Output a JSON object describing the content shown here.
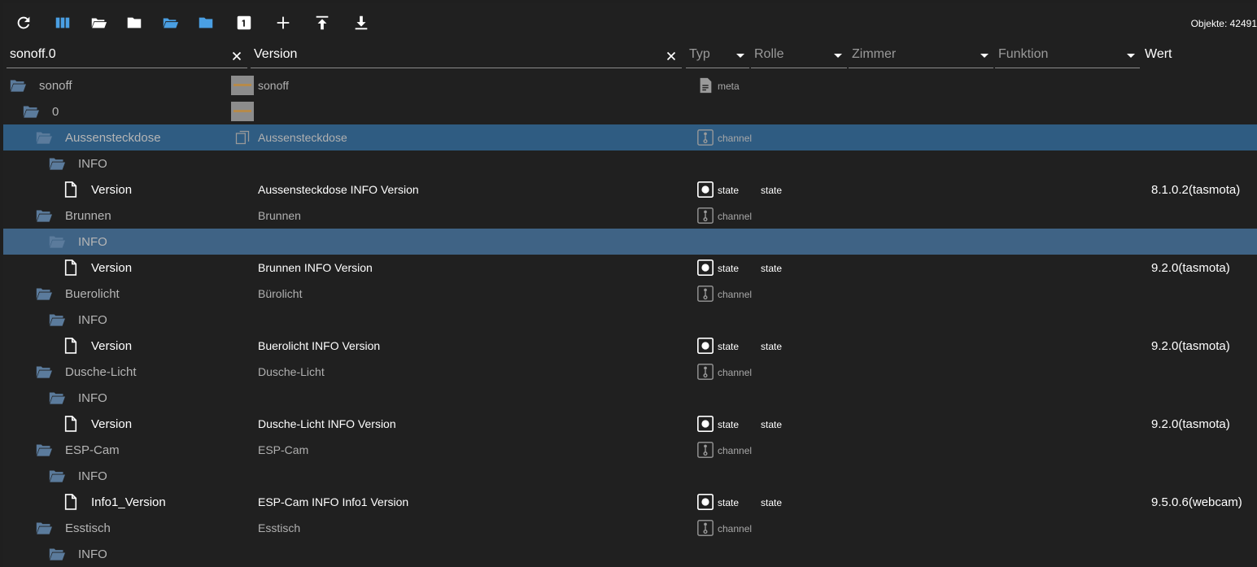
{
  "toolbar": {
    "buttons": [
      {
        "name": "refresh-icon"
      },
      {
        "name": "columns-icon"
      },
      {
        "name": "folder-open-icon"
      },
      {
        "name": "folder-closed-icon"
      },
      {
        "name": "folder-open-blue-icon"
      },
      {
        "name": "folder-closed-blue-icon"
      },
      {
        "name": "number-one-icon"
      },
      {
        "name": "plus-icon"
      },
      {
        "name": "upload-icon"
      },
      {
        "name": "download-icon"
      }
    ],
    "objects_count": "Objekte: 42491"
  },
  "filters": {
    "id": "sonoff.0",
    "name": "Version",
    "typ": "Typ",
    "rolle": "Rolle",
    "zimmer": "Zimmer",
    "funktion": "Funktion",
    "wert": "Wert"
  },
  "colors": {
    "accent_blue": "#4a9fe3",
    "folder_icon": "#5b7b9c",
    "selected_row": "#2f5c82",
    "selected_row_2": "#3f6385"
  },
  "rows": [
    {
      "name": "sonoff",
      "title": "sonoff",
      "type": "meta",
      "role": "",
      "value": "",
      "icon": "folder-open-icon",
      "title_icon": "image"
    },
    {
      "name": "0",
      "title": "",
      "type": "",
      "role": "",
      "value": "",
      "icon": "folder-open-icon",
      "title_icon": "image"
    },
    {
      "name": "Aussensteckdose",
      "title": "Aussensteckdose",
      "type": "channel",
      "role": "",
      "value": "",
      "icon": "folder-open-icon",
      "title_icon": "copy"
    },
    {
      "name": "INFO",
      "title": "",
      "type": "",
      "role": "",
      "value": "",
      "icon": "folder-open-icon"
    },
    {
      "name": "Version",
      "title": "Aussensteckdose INFO Version",
      "type": "state",
      "role": "state",
      "value": "8.1.0.2(tasmota)",
      "icon": "file-icon"
    },
    {
      "name": "Brunnen",
      "title": "Brunnen",
      "type": "channel",
      "role": "",
      "value": "",
      "icon": "folder-open-icon"
    },
    {
      "name": "INFO",
      "title": "",
      "type": "",
      "role": "",
      "value": "",
      "icon": "folder-open-icon"
    },
    {
      "name": "Version",
      "title": "Brunnen INFO Version",
      "type": "state",
      "role": "state",
      "value": "9.2.0(tasmota)",
      "icon": "file-icon"
    },
    {
      "name": "Buerolicht",
      "title": "Bürolicht",
      "type": "channel",
      "role": "",
      "value": "",
      "icon": "folder-open-icon"
    },
    {
      "name": "INFO",
      "title": "",
      "type": "",
      "role": "",
      "value": "",
      "icon": "folder-open-icon"
    },
    {
      "name": "Version",
      "title": "Buerolicht INFO Version",
      "type": "state",
      "role": "state",
      "value": "9.2.0(tasmota)",
      "icon": "file-icon"
    },
    {
      "name": "Dusche-Licht",
      "title": "Dusche-Licht",
      "type": "channel",
      "role": "",
      "value": "",
      "icon": "folder-open-icon"
    },
    {
      "name": "INFO",
      "title": "",
      "type": "",
      "role": "",
      "value": "",
      "icon": "folder-open-icon"
    },
    {
      "name": "Version",
      "title": "Dusche-Licht INFO Version",
      "type": "state",
      "role": "state",
      "value": "9.2.0(tasmota)",
      "icon": "file-icon"
    },
    {
      "name": "ESP-Cam",
      "title": "ESP-Cam",
      "type": "channel",
      "role": "",
      "value": "",
      "icon": "folder-open-icon"
    },
    {
      "name": "INFO",
      "title": "",
      "type": "",
      "role": "",
      "value": "",
      "icon": "folder-open-icon"
    },
    {
      "name": "Info1_Version",
      "title": "ESP-Cam INFO Info1 Version",
      "type": "state",
      "role": "state",
      "value": "9.5.0.6(webcam)",
      "icon": "file-icon"
    },
    {
      "name": "Esstisch",
      "title": "Esstisch",
      "type": "channel",
      "role": "",
      "value": "",
      "icon": "folder-open-icon"
    },
    {
      "name": "INFO",
      "title": "",
      "type": "",
      "role": "",
      "value": "",
      "icon": "folder-open-icon"
    }
  ]
}
